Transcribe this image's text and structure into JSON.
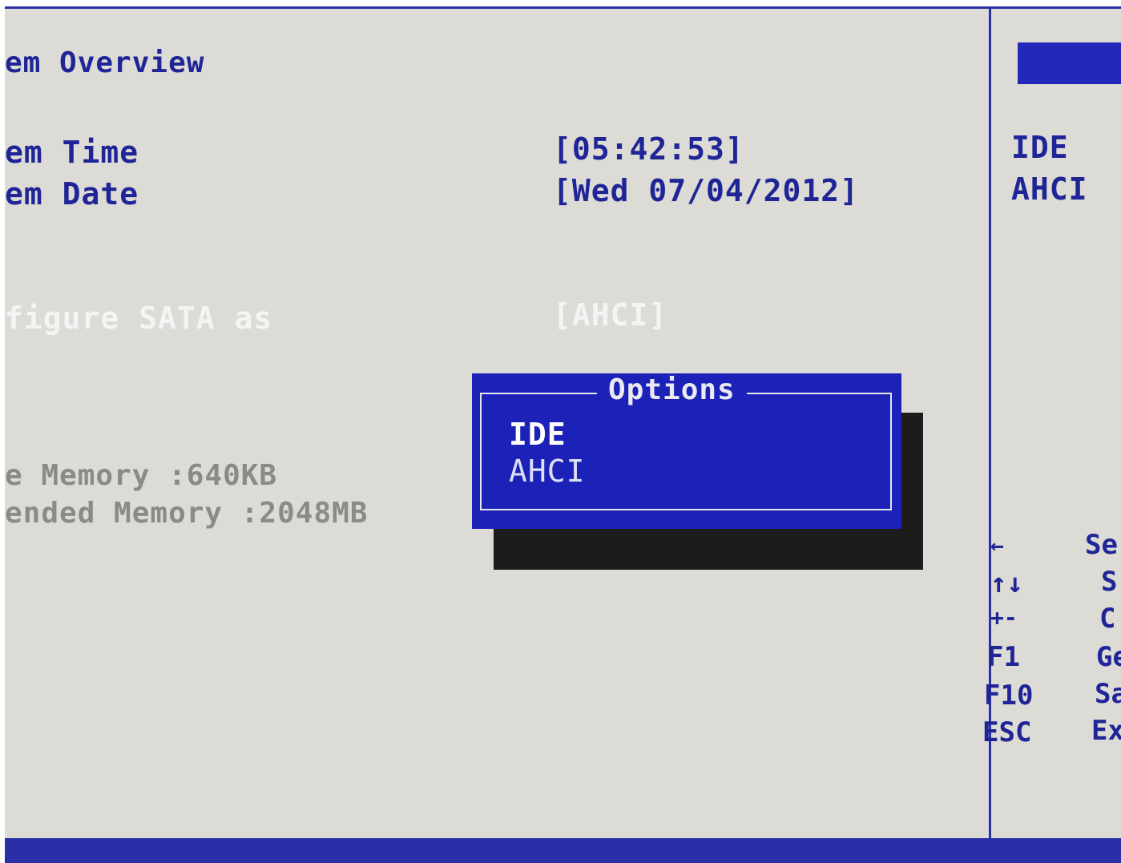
{
  "main": {
    "overview_title": "em Overview",
    "time_label": "em Time",
    "date_label": "em Date",
    "time_value": "[05:42:53]",
    "date_value": "[Wed 07/04/2012]",
    "sata_label": "figure SATA as",
    "sata_value": "[AHCI]",
    "base_memory": "e Memory :640KB",
    "extended_memory": "ended Memory :2048MB"
  },
  "popup": {
    "title": "Options",
    "options": [
      {
        "label": "IDE",
        "selected": true
      },
      {
        "label": "AHCI",
        "selected": false
      }
    ]
  },
  "help": {
    "lines": [
      "IDE",
      "AHCI"
    ]
  },
  "keys": [
    {
      "key": "←",
      "desc": "Se"
    },
    {
      "key": "↑↓",
      "desc": "S"
    },
    {
      "key": "+-",
      "desc": "C"
    },
    {
      "key": "F1",
      "desc": "Ge"
    },
    {
      "key": "F10",
      "desc": "Sa"
    },
    {
      "key": "ESC",
      "desc": "Ex"
    }
  ],
  "colors": {
    "background": "#dcdbd6",
    "accent_blue": "#1c22b8",
    "text_navy": "#1f2596",
    "text_white": "#f4f4f4",
    "text_grey": "#8c8a86"
  }
}
